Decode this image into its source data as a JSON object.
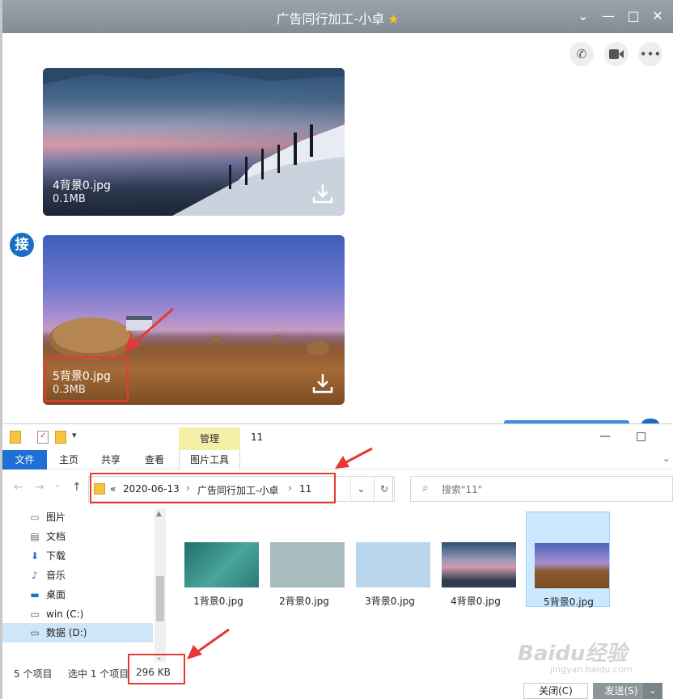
{
  "chat": {
    "title": "广告同行加工-小卓",
    "star_icon": "star-icon",
    "avatar_text": "接",
    "images": [
      {
        "name": "4背景0.jpg",
        "size": "0.1MB"
      },
      {
        "name": "5背景0.jpg",
        "size": "0.3MB"
      }
    ],
    "close_label": "关闭(C)",
    "send_label": "发送(S)"
  },
  "explorer": {
    "manage_tab": "管理",
    "folder_name": "11",
    "tabs": {
      "file": "文件",
      "home": "主页",
      "share": "共享",
      "view": "查看",
      "picture_tools": "图片工具"
    },
    "address": {
      "prefix": "«",
      "segments": [
        "2020-06-13",
        "广告同行加工-小卓",
        "11"
      ]
    },
    "search_placeholder": "搜索\"11\"",
    "nav_items": [
      {
        "label": "图片",
        "icon": "pictures-icon"
      },
      {
        "label": "文档",
        "icon": "documents-icon"
      },
      {
        "label": "下载",
        "icon": "download-icon"
      },
      {
        "label": "音乐",
        "icon": "music-icon"
      },
      {
        "label": "桌面",
        "icon": "desktop-icon"
      },
      {
        "label": "win (C:)",
        "icon": "drive-icon"
      },
      {
        "label": "数据 (D:)",
        "icon": "drive-icon"
      }
    ],
    "files": [
      {
        "label": "1背景0.jpg"
      },
      {
        "label": "2背景0.jpg"
      },
      {
        "label": "3背景0.jpg"
      },
      {
        "label": "4背景0.jpg"
      },
      {
        "label": "5背景0.jpg"
      }
    ],
    "status": {
      "count": "5 个项目",
      "selected": "选中 1 个项目",
      "size": "296 KB"
    }
  },
  "watermark": {
    "text": "Baidu经验",
    "sub": "jingyan.baidu.com"
  },
  "colors": {
    "accent": "#1e6fd6",
    "highlight_red": "#e53935",
    "selection": "#cce8ff"
  }
}
